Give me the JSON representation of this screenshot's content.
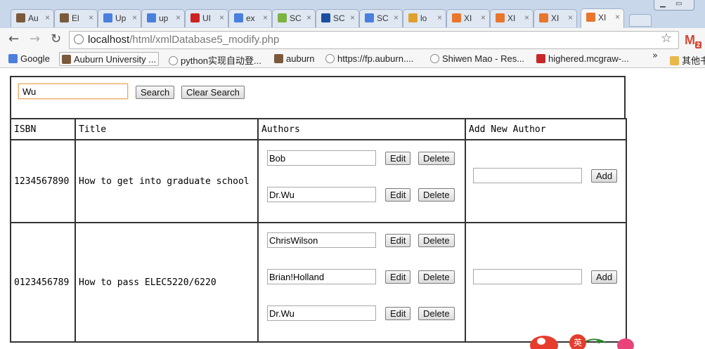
{
  "tabs": [
    {
      "label": "Au",
      "icon": "auburn-tiger-icon",
      "color": "#7a5a3a"
    },
    {
      "label": "El",
      "icon": "auburn-tiger-icon",
      "color": "#7a5a3a"
    },
    {
      "label": "Up",
      "icon": "google-icon",
      "color": "#4a7fdd"
    },
    {
      "label": "up",
      "icon": "google-icon",
      "color": "#4a7fdd"
    },
    {
      "label": "UI",
      "icon": "opera-icon",
      "color": "#cc2222"
    },
    {
      "label": "ex",
      "icon": "google-icon",
      "color": "#4a7fdd"
    },
    {
      "label": "SC",
      "icon": "w3schools-icon",
      "color": "#7cb342"
    },
    {
      "label": "SC",
      "icon": "t-icon",
      "color": "#1a4fa0"
    },
    {
      "label": "SC",
      "icon": "google-icon",
      "color": "#4a7fdd"
    },
    {
      "label": "lo",
      "icon": "phpmyadmin-icon",
      "color": "#e0a030"
    },
    {
      "label": "XI",
      "icon": "xampp-icon",
      "color": "#e8762c"
    },
    {
      "label": "XI",
      "icon": "xampp-icon",
      "color": "#e8762c"
    },
    {
      "label": "XI",
      "icon": "xampp-icon",
      "color": "#e8762c"
    },
    {
      "label": "XI",
      "icon": "xampp-icon",
      "color": "#e8762c"
    }
  ],
  "address": {
    "host": "localhost",
    "path": "/html/xmlDatabase5_modify.php"
  },
  "gmail_count": "2",
  "bookmarks": [
    {
      "label": "Google",
      "icon": "google-icon"
    },
    {
      "label": "Auburn University ...",
      "icon": "auburn-tiger-icon"
    },
    {
      "label": "python实现自动登...",
      "icon": "globe-icon"
    },
    {
      "label": "auburn",
      "icon": "auburn-tiger-icon"
    },
    {
      "label": "https://fp.auburn....",
      "icon": "globe-icon"
    },
    {
      "label": "Shiwen Mao - Res...",
      "icon": "globe-icon"
    },
    {
      "label": "highered.mcgraw-...",
      "icon": "mcgraw-icon"
    },
    {
      "label": "其他书签",
      "icon": "folder-icon"
    }
  ],
  "bookmarks_more": "»",
  "search": {
    "value": "Wu",
    "search_label": "Search",
    "clear_label": "Clear Search"
  },
  "table": {
    "headers": [
      "ISBN",
      "Title",
      "Authors",
      "Add New Author"
    ],
    "rows": [
      {
        "isbn": "1234567890",
        "title": "How to get into graduate school",
        "authors": [
          "Bob",
          "Dr.Wu"
        ]
      },
      {
        "isbn": "0123456789",
        "title": "How to pass ELEC5220/6220",
        "authors": [
          "ChrisWilson",
          "Brian!Holland",
          "Dr.Wu"
        ]
      }
    ],
    "edit_label": "Edit",
    "delete_label": "Delete",
    "add_label": "Add"
  },
  "mascot_text": "英"
}
